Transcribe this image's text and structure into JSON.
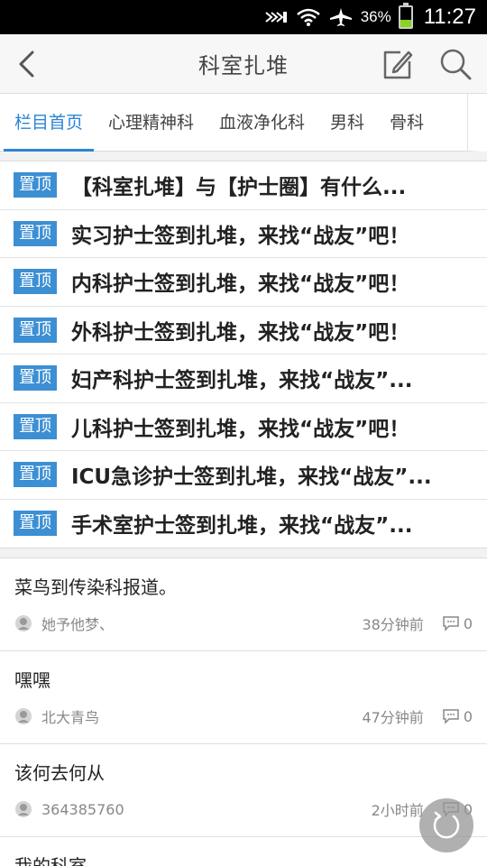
{
  "status_bar": {
    "battery_percent": "36%",
    "battery_level": 0.36,
    "time": "11:27",
    "icons": [
      "nfc-icon",
      "wifi-icon",
      "airplane-mode-icon",
      "battery-icon"
    ]
  },
  "header": {
    "title": "科室扎堆",
    "icons": [
      "back-icon",
      "edit-icon",
      "search-icon"
    ]
  },
  "tabs": [
    {
      "label": "栏目首页",
      "active": true
    },
    {
      "label": "心理精神科",
      "active": false
    },
    {
      "label": "血液净化科",
      "active": false
    },
    {
      "label": "男科",
      "active": false
    },
    {
      "label": "骨科",
      "active": false
    }
  ],
  "pinned": {
    "tag": "置顶",
    "items": [
      "【科室扎堆】与【护士圈】有什么...",
      "实习护士签到扎堆，来找“战友”吧！",
      "内科护士签到扎堆，来找“战友”吧！",
      "外科护士签到扎堆，来找“战友”吧！",
      "妇产科护士签到扎堆，来找“战友”...",
      "儿科护士签到扎堆，来找“战友”吧！",
      "ICU急诊护士签到扎堆，来找“战友”...",
      "手术室护士签到扎堆，来找“战友”..."
    ]
  },
  "posts": [
    {
      "title": "菜鸟到传染科报道。",
      "author": "她予他梦、",
      "time": "38分钟前",
      "comments": "0"
    },
    {
      "title": "嘿嘿",
      "author": "北大青鸟",
      "time": "47分钟前",
      "comments": "0"
    },
    {
      "title": "该何去何从",
      "author": "364385760",
      "time": "2小时前",
      "comments": "0"
    },
    {
      "title": "我的科室"
    }
  ],
  "colors": {
    "accent": "#2b84d6",
    "pin_tag": "#3c8fd3",
    "battery": "#8cd21e"
  }
}
